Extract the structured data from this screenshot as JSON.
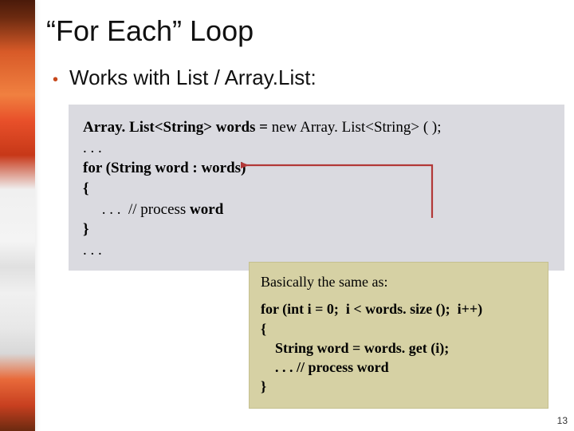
{
  "title": "“For Each” Loop",
  "bullet": "Works with List / Array.List:",
  "box1": {
    "l1a": "Array. List<String> words = ",
    "l1b": "new",
    "l1c": " Array. List<String> ( );",
    "l2": ". . .",
    "l3a": "for (String word : words)",
    "l4": "{",
    "l5": "     . . .  // process ",
    "l5b": "word",
    "l6": "}",
    "l7": ". . ."
  },
  "box2": {
    "lead": "Basically the same as:",
    "c1a": "for (int i = 0;  i < words. size ();  i++)",
    "c2": "{",
    "c3a": "    String word = words. get (i);",
    "c4": "    . . . // process word",
    "c5": "}"
  },
  "pageNumber": "13"
}
